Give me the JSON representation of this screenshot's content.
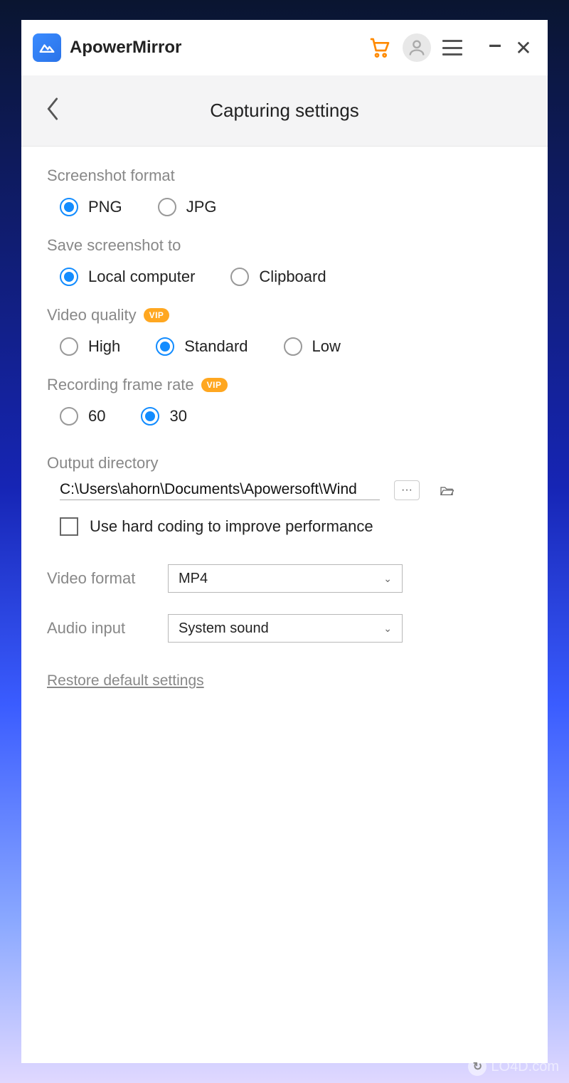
{
  "app_name": "ApowerMirror",
  "page_title": "Capturing settings",
  "sections": {
    "screenshot_format": {
      "label": "Screenshot format",
      "options": [
        "PNG",
        "JPG"
      ],
      "selected": "PNG"
    },
    "save_to": {
      "label": "Save screenshot to",
      "options": [
        "Local computer",
        "Clipboard"
      ],
      "selected": "Local computer"
    },
    "video_quality": {
      "label": "Video quality",
      "vip": true,
      "options": [
        "High",
        "Standard",
        "Low"
      ],
      "selected": "Standard"
    },
    "frame_rate": {
      "label": "Recording frame rate",
      "vip": true,
      "options": [
        "60",
        "30"
      ],
      "selected": "30"
    },
    "output_dir": {
      "label": "Output directory",
      "value": "C:\\Users\\ahorn\\Documents\\Apowersoft\\Wind"
    },
    "hard_coding": {
      "label": "Use hard coding to improve performance",
      "checked": false
    },
    "video_format": {
      "label": "Video format",
      "value": "MP4"
    },
    "audio_input": {
      "label": "Audio input",
      "value": "System sound"
    }
  },
  "restore_link": "Restore default settings",
  "vip_text": "VIP",
  "watermark": "LO4D.com"
}
